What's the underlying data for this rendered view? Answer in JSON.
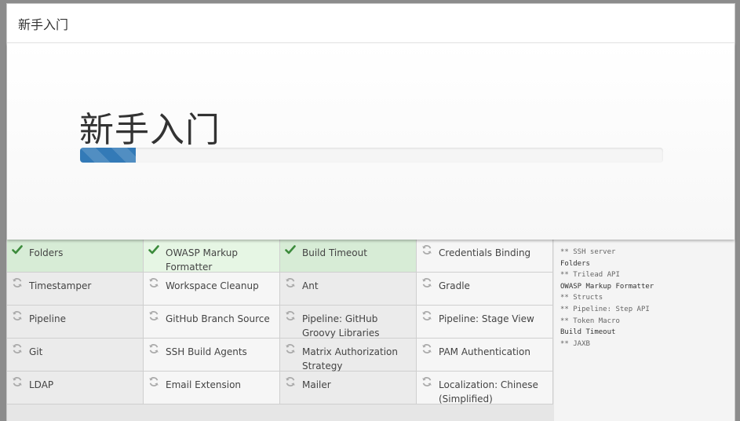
{
  "header": {
    "title": "新手入门"
  },
  "hero": {
    "title": "新手入门",
    "progress": 0.095,
    "progress_color": "#337ab7"
  },
  "plugins": [
    {
      "name": "Folders",
      "status": "success"
    },
    {
      "name": "OWASP Markup Formatter",
      "status": "success"
    },
    {
      "name": "Build Timeout",
      "status": "success"
    },
    {
      "name": "Credentials Binding",
      "status": "pending"
    },
    {
      "name": "Timestamper",
      "status": "pending"
    },
    {
      "name": "Workspace Cleanup",
      "status": "pending"
    },
    {
      "name": "Ant",
      "status": "pending"
    },
    {
      "name": "Gradle",
      "status": "pending"
    },
    {
      "name": "Pipeline",
      "status": "pending"
    },
    {
      "name": "GitHub Branch Source",
      "status": "pending"
    },
    {
      "name": "Pipeline: GitHub Groovy Libraries",
      "status": "pending"
    },
    {
      "name": "Pipeline: Stage View",
      "status": "pending"
    },
    {
      "name": "Git",
      "status": "pending"
    },
    {
      "name": "SSH Build Agents",
      "status": "pending"
    },
    {
      "name": "Matrix Authorization Strategy",
      "status": "pending"
    },
    {
      "name": "PAM Authentication",
      "status": "pending"
    },
    {
      "name": "LDAP",
      "status": "pending"
    },
    {
      "name": "Email Extension",
      "status": "pending"
    },
    {
      "name": "Mailer",
      "status": "pending"
    },
    {
      "name": "Localization: Chinese (Simplified)",
      "status": "pending"
    }
  ],
  "icons": {
    "success": "check-icon",
    "pending": "refresh-icon"
  },
  "colors": {
    "success_icon": "#3c8b3c",
    "pending_icon": "#a9a9a9"
  },
  "log": [
    "** SSH server",
    "Folders",
    "** Trilead API",
    "OWASP Markup Formatter",
    "** Structs",
    "** Pipeline: Step API",
    "** Token Macro",
    "Build Timeout",
    "** JAXB"
  ]
}
